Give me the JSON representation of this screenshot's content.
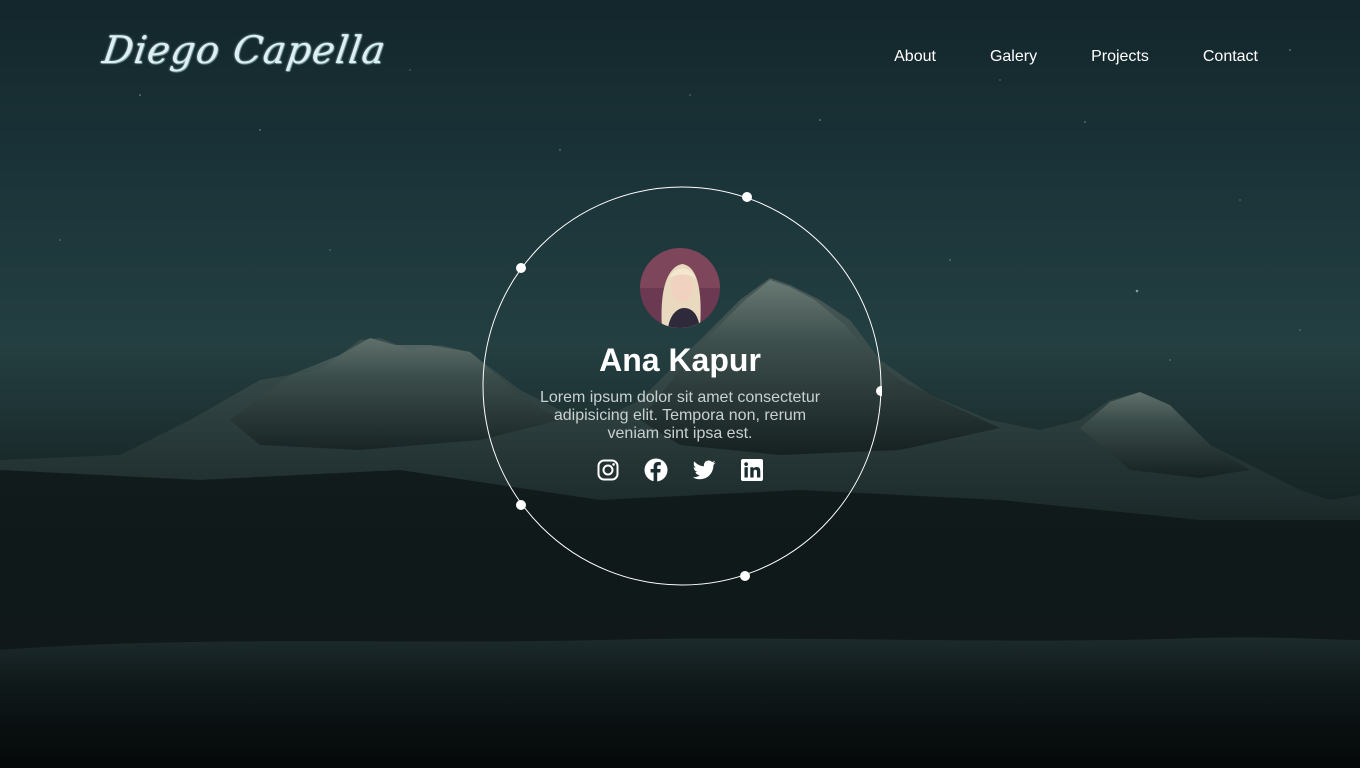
{
  "header": {
    "logo": "Diego Capella",
    "nav": [
      {
        "label": "About"
      },
      {
        "label": "Galery"
      },
      {
        "label": "Projects"
      },
      {
        "label": "Contact"
      }
    ]
  },
  "profile": {
    "name": "Ana Kapur",
    "bio": "Lorem ipsum dolor sit amet consectetur adipisicing elit. Tempora non, rerum veniam sint ipsa est.",
    "socials": [
      {
        "icon": "instagram-icon"
      },
      {
        "icon": "facebook-icon"
      },
      {
        "icon": "twitter-icon"
      },
      {
        "icon": "linkedin-icon"
      }
    ]
  },
  "colors": {
    "text": "#ffffff",
    "bio_text": "#c9d0d1",
    "sky_top": "#13262b",
    "sky_mid": "#243f41"
  }
}
